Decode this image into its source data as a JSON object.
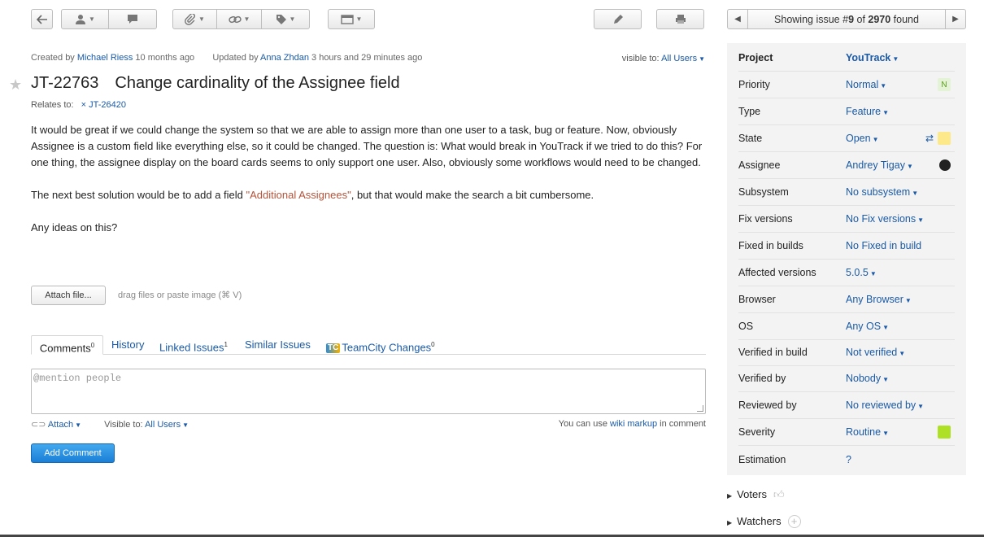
{
  "pager": {
    "prefix": "Showing issue #",
    "index": "9",
    "of": " of ",
    "total": "2970",
    "suffix": " found"
  },
  "meta": {
    "created_label": "Created by ",
    "created_by": "Michael Riess",
    "created_when": " 10 months ago",
    "updated_label": "Updated by ",
    "updated_by": "Anna Zhdan",
    "updated_when": " 3 hours and 29 minutes ago"
  },
  "visibility": {
    "label": "visible to: ",
    "value": "All Users"
  },
  "issue": {
    "id": "JT-22763",
    "summary": "Change cardinality of the Assignee field"
  },
  "relates": {
    "label": "Relates to:",
    "link": "JT-26420"
  },
  "description": {
    "p1": "It would be great if we could change the system so that we are able to assign more than one user to a task, bug or feature. Now, obviously Assignee is a custom field like everything else, so it could be changed. The question is: What would break in YouTrack if we tried to do this? For one thing, the assignee display on the board cards seems to only support one user. Also, obviously some workflows would need to be changed.",
    "p2a": "The next best solution would be to add a field ",
    "p2q": "\"Additional Assignees\"",
    "p2b": ", but that would make the search a bit cumbersome.",
    "p3": "Any ideas on this?"
  },
  "attach": {
    "button": "Attach file...",
    "hint": "drag files or paste image (⌘ V)"
  },
  "tabs": [
    {
      "label": "Comments",
      "count": "0"
    },
    {
      "label": "History",
      "count": ""
    },
    {
      "label": "Linked Issues",
      "count": "1"
    },
    {
      "label": "Similar Issues",
      "count": ""
    },
    {
      "label": "TeamCity Changes",
      "count": "0"
    }
  ],
  "comment": {
    "placeholder": "@mention people",
    "attach_label": "Attach",
    "visible_label": "Visible to: ",
    "visible_value": "All Users",
    "wiki_prefix": "You can use ",
    "wiki_link": "wiki markup",
    "wiki_suffix": " in comment",
    "submit": "Add Comment"
  },
  "fields": [
    {
      "name": "Project",
      "value": "YouTrack",
      "badge": ""
    },
    {
      "name": "Priority",
      "value": "Normal",
      "badge": "N"
    },
    {
      "name": "Type",
      "value": "Feature",
      "badge": ""
    },
    {
      "name": "State",
      "value": "Open",
      "badge": ""
    },
    {
      "name": "Assignee",
      "value": "Andrey Tigay",
      "badge": ""
    },
    {
      "name": "Subsystem",
      "value": "No subsystem",
      "badge": ""
    },
    {
      "name": "Fix versions",
      "value": "No Fix versions",
      "badge": ""
    },
    {
      "name": "Fixed in builds",
      "value": "No Fixed in build",
      "badge": ""
    },
    {
      "name": "Affected versions",
      "value": "5.0.5",
      "badge": ""
    },
    {
      "name": "Browser",
      "value": "Any Browser",
      "badge": ""
    },
    {
      "name": "OS",
      "value": "Any OS",
      "badge": ""
    },
    {
      "name": "Verified in build",
      "value": "Not verified",
      "badge": ""
    },
    {
      "name": "Verified by",
      "value": "Nobody",
      "badge": ""
    },
    {
      "name": "Reviewed by",
      "value": "No reviewed by",
      "badge": ""
    },
    {
      "name": "Severity",
      "value": "Routine",
      "badge": ""
    },
    {
      "name": "Estimation",
      "value": "?",
      "badge": ""
    }
  ],
  "colors": {
    "priority_badge": "#e4f3d6",
    "state_badge": "#fde98a",
    "severity_badge": "#aee025",
    "link": "#1a5aa6",
    "primary_button": "#1a7fd6"
  },
  "sidebar": {
    "voters": "Voters",
    "watchers": "Watchers"
  }
}
